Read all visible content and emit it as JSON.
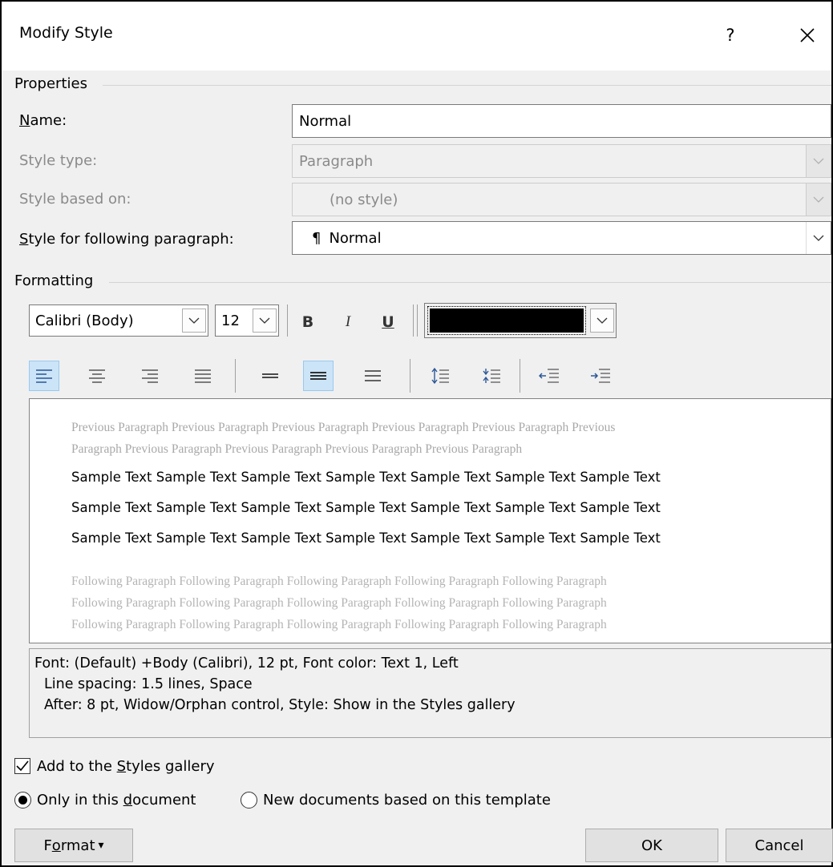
{
  "dialog": {
    "title": "Modify Style",
    "help": "?"
  },
  "properties": {
    "group_label": "Properties",
    "name_label_ul": "N",
    "name_label_rest": "ame:",
    "name_value": "Normal",
    "style_type_label": "Style type:",
    "style_type_value": "Paragraph",
    "based_on_label": "Style based on:",
    "based_on_value": "(no style)",
    "following_label_ul": "S",
    "following_label_rest": "tyle for following paragraph:",
    "following_mark": "¶",
    "following_value": "Normal"
  },
  "formatting": {
    "group_label": "Formatting",
    "font": "Calibri (Body)",
    "size": "12",
    "bold": "B",
    "italic": "I",
    "underline": "U",
    "font_color": "#000000"
  },
  "preview": {
    "previous_line1": "Previous Paragraph Previous Paragraph Previous Paragraph Previous Paragraph Previous Paragraph Previous",
    "previous_line2": "Paragraph Previous Paragraph Previous Paragraph Previous Paragraph Previous Paragraph",
    "sample_line": "Sample Text Sample Text Sample Text Sample Text Sample Text Sample Text Sample Text",
    "following_line1": "Following Paragraph Following Paragraph Following Paragraph Following Paragraph Following Paragraph",
    "following_line2": "Following Paragraph Following Paragraph Following Paragraph Following Paragraph Following Paragraph",
    "following_line3": "Following Paragraph Following Paragraph Following Paragraph Following Paragraph Following Paragraph"
  },
  "description": {
    "line1": "Font: (Default) +Body (Calibri), 12 pt, Font color: Text 1, Left",
    "line2": "Line spacing:  1.5 lines, Space",
    "line3": "After:  8 pt, Widow/Orphan control, Style: Show in the Styles gallery"
  },
  "options": {
    "add_gallery_pre": "Add to the ",
    "add_gallery_ul": "S",
    "add_gallery_post": "tyles gallery",
    "add_gallery_checked": true,
    "only_doc_pre": "Only in this ",
    "only_doc_ul": "d",
    "only_doc_post": "ocument",
    "new_docs": "New documents based on this template",
    "selected_radio": "only_doc"
  },
  "buttons": {
    "format_pre": "F",
    "format_ul": "o",
    "format_post": "rmat",
    "format_arrow": "▾",
    "ok": "OK",
    "cancel": "Cancel"
  }
}
